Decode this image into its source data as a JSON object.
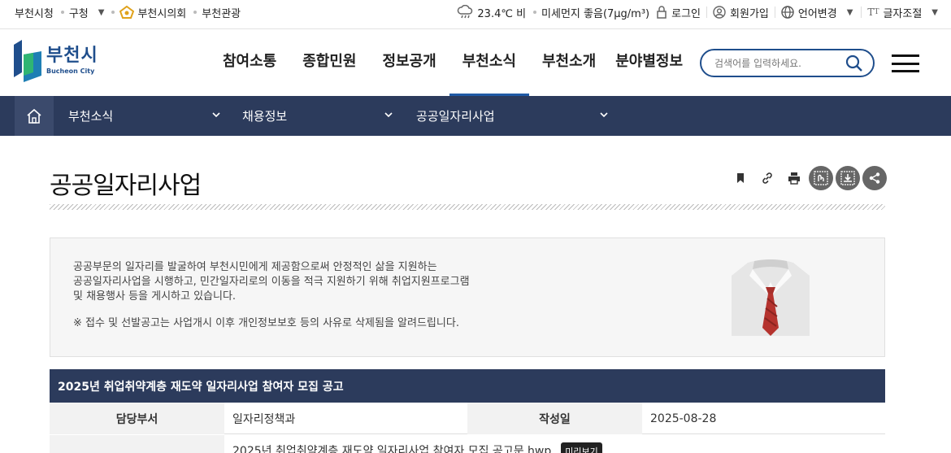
{
  "util_bar": {
    "left_links": [
      "부천시청",
      "구청",
      "부천시의회",
      "부천관광"
    ],
    "weather": "23.4℃ 비",
    "dust": "미세먼지 좋음(7μg/m³)",
    "login": "로그인",
    "signup": "회원가입",
    "language": "언어변경",
    "font_size": "글자조절"
  },
  "header": {
    "logo_ko": "부천시",
    "logo_en": "Bucheon City",
    "nav": [
      "참여소통",
      "종합민원",
      "정보공개",
      "부천소식",
      "부천소개",
      "분야별정보"
    ],
    "active_nav": "부천소식",
    "search_placeholder": "검색어를 입력하세요."
  },
  "location": {
    "depth1": "부천소식",
    "depth2": "채용정보",
    "depth3": "공공일자리사업"
  },
  "page": {
    "title": "공공일자리사업",
    "intro_lines": [
      "공공부문의 일자리를 발굴하여 부천시민에게 제공함으로써 안정적인 삶을 지원하는",
      "공공일자리사업을 시행하고, 민간일자리로의 이동을 적극 지원하기 위해 취업지원프로그램",
      "및 채용행사 등을 게시하고 있습니다."
    ],
    "notice": "※ 접수 및 선발공고는 사업개시 이후 개인정보보호 등의 사유로 삭제됨을 알려드립니다."
  },
  "post": {
    "title": "2025년 취업취약계층 재도약 일자리사업 참여자 모집 공고",
    "dept_label": "담당부서",
    "dept": "일자리정책과",
    "date_label": "작성일",
    "date": "2025-08-28",
    "attachment": "2025년 취업취약계층 재도약 일자리사업 참여자 모집 공고문.hwp",
    "preview_label": "미리보기"
  },
  "colors": {
    "navy": "#2c3b5c",
    "brand_blue": "#1f4e8c",
    "tie_red": "#b5332e"
  }
}
